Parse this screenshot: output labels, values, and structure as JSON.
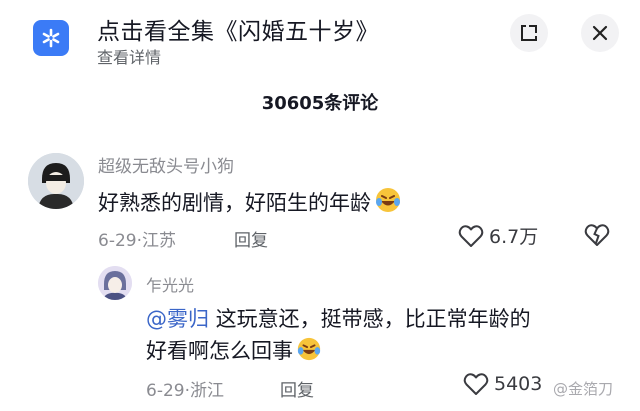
{
  "header": {
    "title": "点击看全集《闪婚五十岁》",
    "subtitle": "查看详情",
    "app_icon": "snowflake-icon",
    "minimize_icon": "corner-arrow-icon",
    "close_icon": "close-icon"
  },
  "comment_count": "30605条评论",
  "comments": [
    {
      "username": "超级无敌头号小狗",
      "text": "好熟悉的剧情，好陌生的年龄",
      "meta": "6-29·江苏",
      "reply_label": "回复",
      "likes": "6.7万",
      "emoji": "laughing-tears-emoji"
    }
  ],
  "reply": {
    "username": "乍光光",
    "mention": "@雾归",
    "text_line1": " 这玩意还，挺带感，比正常年龄的",
    "text_line2": "好看啊怎么回事",
    "meta": "6-29·浙江",
    "reply_label": "回复",
    "likes": "5403"
  },
  "watermark": "@金箔刀",
  "colors": {
    "accent_blue": "#3b7bf6",
    "mention_blue": "#3b66c8",
    "text_primary": "#161823",
    "text_secondary": "#8a8b91"
  }
}
